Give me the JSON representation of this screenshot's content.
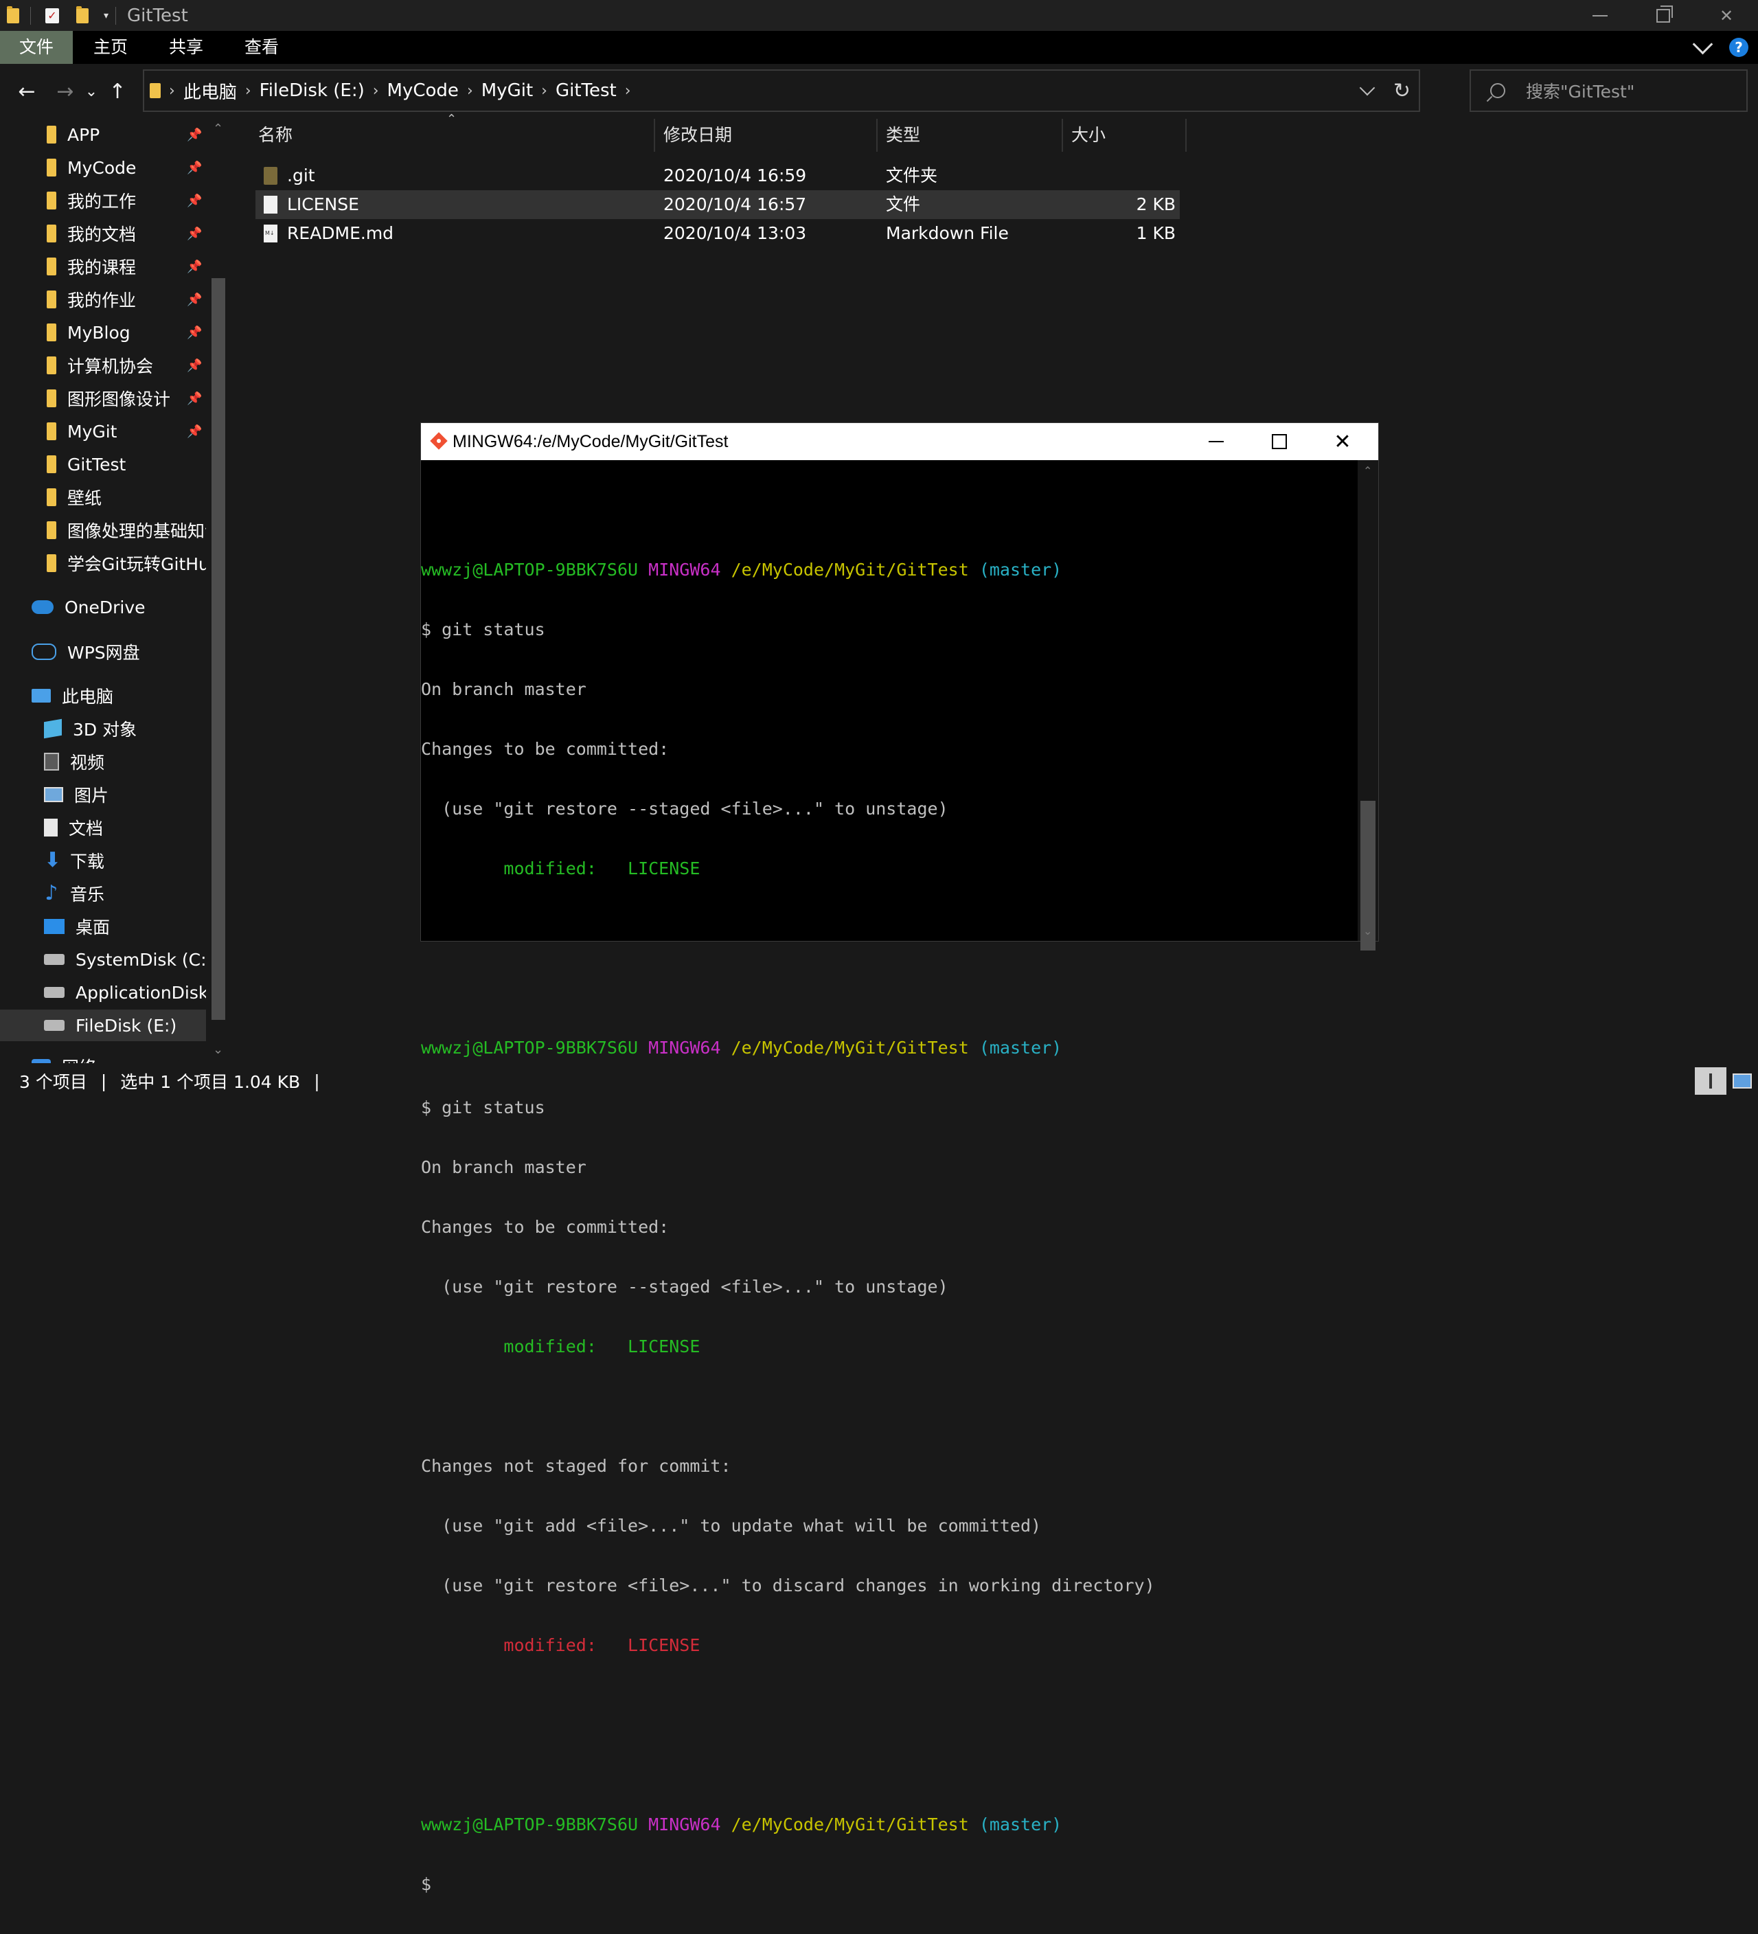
{
  "window": {
    "title": "GitTest"
  },
  "ribbon": {
    "tabs": [
      "文件",
      "主页",
      "共享",
      "查看"
    ],
    "help": "?"
  },
  "navigation": {
    "back": "←",
    "forward": "→",
    "recent": "⌄",
    "up": "↑",
    "breadcrumb": [
      "此电脑",
      "FileDisk (E:)",
      "MyCode",
      "MyGit",
      "GitTest"
    ],
    "breadcrumb_sep": "›",
    "refresh": "↻"
  },
  "search": {
    "placeholder": "搜索\"GitTest\""
  },
  "nav_pane": {
    "quick_access": [
      "APP",
      "MyCode",
      "我的工作",
      "我的文档",
      "我的课程",
      "我的作业",
      "MyBlog",
      "计算机协会",
      "图形图像设计",
      "MyGit",
      "GitTest",
      "壁纸",
      "图像处理的基础知识",
      "学会Git玩转GitHub"
    ],
    "pin": "📌",
    "onedrive": "OneDrive",
    "wps": "WPS网盘",
    "this_pc": "此电脑",
    "pc_items": [
      "3D 对象",
      "视频",
      "图片",
      "文档",
      "下载",
      "音乐",
      "桌面",
      "SystemDisk (C:)",
      "ApplicationDisk (D:)",
      "FileDisk (E:)"
    ],
    "network": "网络"
  },
  "file_list": {
    "columns": [
      "名称",
      "修改日期",
      "类型",
      "大小"
    ],
    "rows": [
      {
        "name": ".git",
        "date": "2020/10/4 16:59",
        "type": "文件夹",
        "size": ""
      },
      {
        "name": "LICENSE",
        "date": "2020/10/4 16:57",
        "type": "文件",
        "size": "2 KB"
      },
      {
        "name": "README.md",
        "date": "2020/10/4 13:03",
        "type": "Markdown File",
        "size": "1 KB"
      }
    ]
  },
  "status": {
    "count": "3 个项目",
    "selected": "选中 1 个项目  1.04 KB",
    "sep": "|"
  },
  "terminal": {
    "title": "MINGW64:/e/MyCode/MyGit/GitTest",
    "prompt_user": "wwwzj@LAPTOP-9BBK7S6U",
    "prompt_env": "MINGW64",
    "prompt_path": "/e/MyCode/MyGit/GitTest",
    "prompt_branch": "(master)",
    "cmd": "$ git status",
    "on_branch": "On branch master",
    "to_be_committed": "Changes to be committed:",
    "hint_unstage": "  (use \"git restore --staged <file>...\" to unstage)",
    "modified_label": "        modified:   LICENSE",
    "not_staged": "Changes not staged for commit:",
    "hint_add": "  (use \"git add <file>...\" to update what will be committed)",
    "hint_restore": "  (use \"git restore <file>...\" to discard changes in working directory)",
    "cursor_prompt": "$",
    "colors": {
      "user": "#25bc24",
      "env": "#c930c7",
      "path": "#c7c400",
      "branch": "#29b1c5",
      "staged": "#25bc24",
      "unstaged": "#d42c3a"
    }
  }
}
